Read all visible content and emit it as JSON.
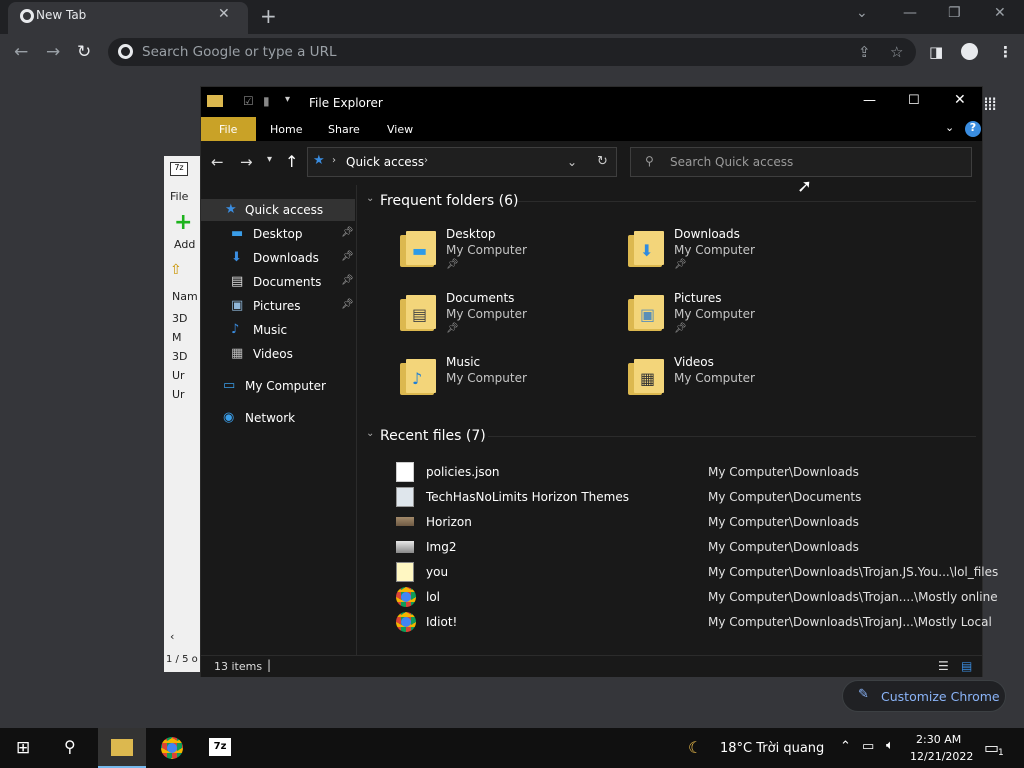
{
  "chrome": {
    "tab_title": "New Tab",
    "omnibox_placeholder": "Search Google or type a URL",
    "customize_label": "Customize Chrome"
  },
  "sevenzip": {
    "menu_file": "File",
    "add_label": "Add",
    "col_name": "Nam",
    "rows": [
      "3D",
      "M",
      "3D",
      "Ur",
      "Ur"
    ],
    "status": "1 / 5 o"
  },
  "explorer": {
    "title": "File Explorer",
    "ribbon": {
      "file": "File",
      "home": "Home",
      "share": "Share",
      "view": "View"
    },
    "address": "Quick access",
    "search_placeholder": "Search Quick access",
    "nav": [
      {
        "label": "Quick access",
        "icon": "star-icon",
        "pinned": false
      },
      {
        "label": "Desktop",
        "icon": "desktop-icon",
        "pinned": true
      },
      {
        "label": "Downloads",
        "icon": "download-icon",
        "pinned": true
      },
      {
        "label": "Documents",
        "icon": "document-icon",
        "pinned": true
      },
      {
        "label": "Pictures",
        "icon": "pictures-icon",
        "pinned": true
      },
      {
        "label": "Music",
        "icon": "music-icon",
        "pinned": false
      },
      {
        "label": "Videos",
        "icon": "videos-icon",
        "pinned": false
      },
      {
        "label": "My Computer",
        "icon": "computer-icon",
        "pinned": false
      },
      {
        "label": "Network",
        "icon": "network-icon",
        "pinned": false
      }
    ],
    "frequent_header": "Frequent folders (6)",
    "frequent": [
      {
        "name": "Desktop",
        "location": "My Computer",
        "pinned": true,
        "icon": "desktop-icon"
      },
      {
        "name": "Downloads",
        "location": "My Computer",
        "pinned": true,
        "icon": "download-icon"
      },
      {
        "name": "Documents",
        "location": "My Computer",
        "pinned": true,
        "icon": "document-icon"
      },
      {
        "name": "Pictures",
        "location": "My Computer",
        "pinned": true,
        "icon": "pictures-icon"
      },
      {
        "name": "Music",
        "location": "My Computer",
        "pinned": false,
        "icon": "music-icon"
      },
      {
        "name": "Videos",
        "location": "My Computer",
        "pinned": false,
        "icon": "videos-icon"
      }
    ],
    "recent_header": "Recent files (7)",
    "recent": [
      {
        "name": "policies.json",
        "path": "My Computer\\Downloads",
        "icon": "file-icon"
      },
      {
        "name": "TechHasNoLimits Horizon Themes",
        "path": "My Computer\\Documents",
        "icon": "theme-icon"
      },
      {
        "name": "Horizon",
        "path": "My Computer\\Downloads",
        "icon": "image-icon"
      },
      {
        "name": "Img2",
        "path": "My Computer\\Downloads",
        "icon": "image-icon"
      },
      {
        "name": "you",
        "path": "My Computer\\Downloads\\Trojan.JS.You...\\lol_files",
        "icon": "script-icon"
      },
      {
        "name": "lol",
        "path": "My Computer\\Downloads\\Trojan....\\Mostly online",
        "icon": "chrome-icon"
      },
      {
        "name": "Idiot!",
        "path": "My Computer\\Downloads\\TrojanJ...\\Mostly Local",
        "icon": "chrome-icon"
      }
    ],
    "status": "13 items"
  },
  "taskbar": {
    "weather": "18°C  Trời quang",
    "time": "2:30 AM",
    "date": "12/21/2022",
    "notification_count": "1"
  }
}
